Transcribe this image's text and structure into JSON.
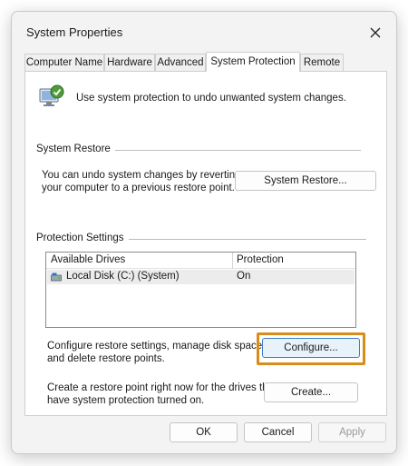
{
  "window": {
    "title": "System Properties",
    "close_glyph": "✕"
  },
  "tabs": [
    {
      "label": "Computer Name",
      "active": false
    },
    {
      "label": "Hardware",
      "active": false
    },
    {
      "label": "Advanced",
      "active": false
    },
    {
      "label": "System Protection",
      "active": true
    },
    {
      "label": "Remote",
      "active": false
    }
  ],
  "intro": {
    "text": "Use system protection to undo unwanted system changes.",
    "icon": "system-protection-icon"
  },
  "system_restore": {
    "group_label": "System Restore",
    "description_line1": "You can undo system changes by reverting",
    "description_line2": "your computer to a previous restore point.",
    "button_label": "System Restore..."
  },
  "protection_settings": {
    "group_label": "Protection Settings",
    "columns": [
      "Available Drives",
      "Protection"
    ],
    "drives": [
      {
        "name": "Local Disk (C:) (System)",
        "protection": "On",
        "icon": "drive-icon"
      }
    ],
    "configure_text_line1": "Configure restore settings, manage disk space,",
    "configure_text_line2": "and delete restore points.",
    "configure_button": "Configure...",
    "create_text_line1": "Create a restore point right now for the drives that",
    "create_text_line2": "have system protection turned on.",
    "create_button": "Create..."
  },
  "footer": {
    "ok": "OK",
    "cancel": "Cancel",
    "apply": "Apply"
  },
  "colors": {
    "highlight": "#d98c1a",
    "accent": "#3c7fc4",
    "dialog_bg": "#f3f3f3"
  }
}
